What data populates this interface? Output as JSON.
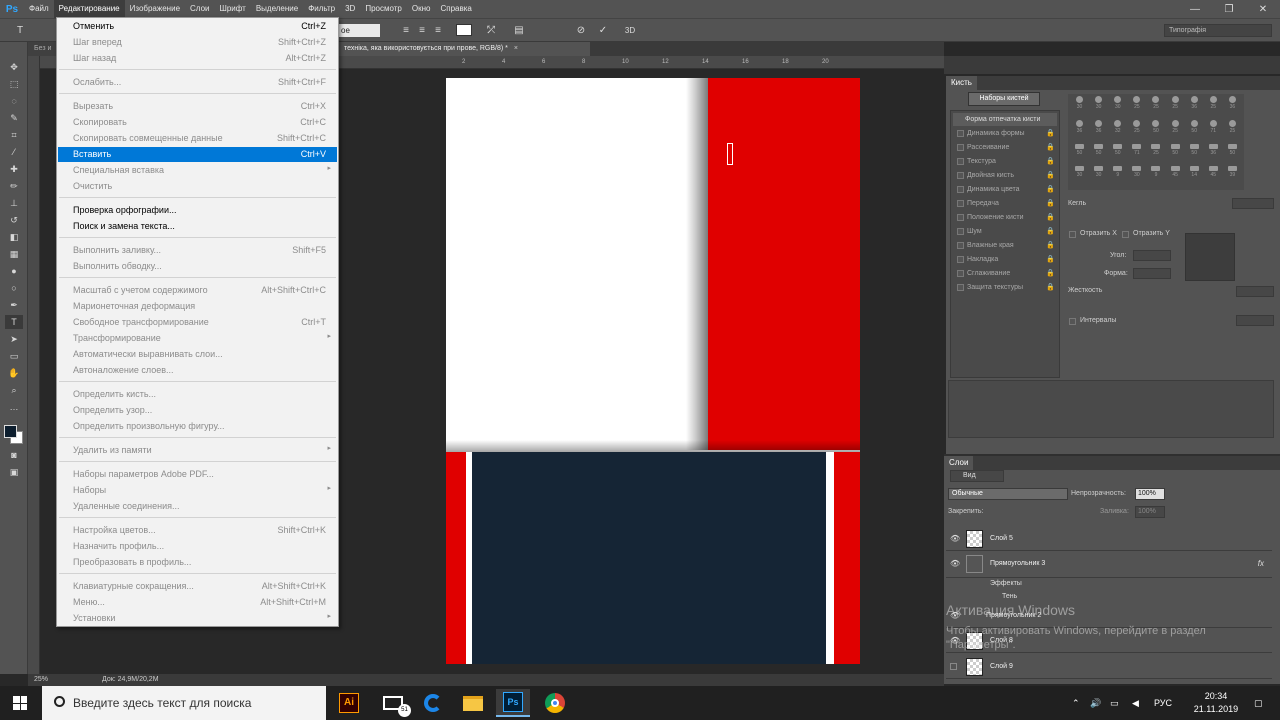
{
  "menubar": {
    "items": [
      "Файл",
      "Редактирование",
      "Изображение",
      "Слои",
      "Шрифт",
      "Выделение",
      "Фильтр",
      "3D",
      "Просмотр",
      "Окно",
      "Справка"
    ],
    "logo": "Ps"
  },
  "options": {
    "font_style": "ое",
    "preset": "Типографія"
  },
  "tabs": [
    {
      "title": "Без и",
      "active": false
    },
    {
      "title": "техніка, яка використовується при прове, RGB/8) *",
      "active": true,
      "close": "×"
    }
  ],
  "ruler_ticks": [
    "2",
    "4",
    "6",
    "8",
    "10",
    "12",
    "14",
    "16",
    "18",
    "20"
  ],
  "canvas_colors": {
    "red": "#e00000",
    "navy": "#152535",
    "white": "#ffffff",
    "grey": "#d8d8d8"
  },
  "edit_menu": {
    "items": [
      {
        "label": "Отменить",
        "shortcut": "Ctrl+Z",
        "disabled": false
      },
      {
        "label": "Шаг вперед",
        "shortcut": "Shift+Ctrl+Z",
        "disabled": true
      },
      {
        "label": "Шаг назад",
        "shortcut": "Alt+Ctrl+Z",
        "disabled": true
      },
      {
        "label": "Ослабить...",
        "shortcut": "Shift+Ctrl+F",
        "disabled": true
      },
      {
        "label": "Вырезать",
        "shortcut": "Ctrl+X",
        "disabled": true
      },
      {
        "label": "Скопировать",
        "shortcut": "Ctrl+C",
        "disabled": true
      },
      {
        "label": "Скопировать совмещенные данные",
        "shortcut": "Shift+Ctrl+C",
        "disabled": true
      },
      {
        "label": "Вставить",
        "shortcut": "Ctrl+V",
        "disabled": false,
        "highlighted": true
      },
      {
        "label": "Специальная вставка",
        "shortcut": "",
        "disabled": true,
        "submenu": true
      },
      {
        "label": "Очистить",
        "shortcut": "",
        "disabled": true
      },
      {
        "label": "Проверка орфографии...",
        "shortcut": "",
        "disabled": false
      },
      {
        "label": "Поиск и замена текста...",
        "shortcut": "",
        "disabled": false
      },
      {
        "label": "Выполнить заливку...",
        "shortcut": "Shift+F5",
        "disabled": true
      },
      {
        "label": "Выполнить обводку...",
        "shortcut": "",
        "disabled": true
      },
      {
        "label": "Масштаб с учетом содержимого",
        "shortcut": "Alt+Shift+Ctrl+C",
        "disabled": true
      },
      {
        "label": "Марионеточная деформация",
        "shortcut": "",
        "disabled": true
      },
      {
        "label": "Свободное трансформирование",
        "shortcut": "Ctrl+T",
        "disabled": true
      },
      {
        "label": "Трансформирование",
        "shortcut": "",
        "disabled": true,
        "submenu": true
      },
      {
        "label": "Автоматически выравнивать слои...",
        "shortcut": "",
        "disabled": true
      },
      {
        "label": "Автоналожение слоев...",
        "shortcut": "",
        "disabled": true
      },
      {
        "label": "Определить кисть...",
        "shortcut": "",
        "disabled": true
      },
      {
        "label": "Определить узор...",
        "shortcut": "",
        "disabled": true
      },
      {
        "label": "Определить произвольную фигуру...",
        "shortcut": "",
        "disabled": true
      },
      {
        "label": "Удалить из памяти",
        "shortcut": "",
        "disabled": true,
        "submenu": true
      },
      {
        "label": "Наборы параметров Adobe PDF...",
        "shortcut": "",
        "disabled": true
      },
      {
        "label": "Наборы",
        "shortcut": "",
        "disabled": true,
        "submenu": true
      },
      {
        "label": "Удаленные соединения...",
        "shortcut": "",
        "disabled": true
      },
      {
        "label": "Настройка цветов...",
        "shortcut": "Shift+Ctrl+K",
        "disabled": true
      },
      {
        "label": "Назначить профиль...",
        "shortcut": "",
        "disabled": true
      },
      {
        "label": "Преобразовать в профиль...",
        "shortcut": "",
        "disabled": true
      },
      {
        "label": "Клавиатурные сокращения...",
        "shortcut": "Alt+Shift+Ctrl+K",
        "disabled": true
      },
      {
        "label": "Меню...",
        "shortcut": "Alt+Shift+Ctrl+M",
        "disabled": true
      },
      {
        "label": "Установки",
        "shortcut": "",
        "disabled": true,
        "submenu": true
      }
    ]
  },
  "brush_panel": {
    "tab": "Кисть",
    "presets_button": "Наборы кистей",
    "sections": [
      "Форма отпечатка кисти",
      "Динамика формы",
      "Рассеивание",
      "Текстура",
      "Двойная кисть",
      "Динамика цвета",
      "Передача",
      "Положение кисти",
      "Шум",
      "Влажные края",
      "Накладка",
      "Сглаживание",
      "Защита текстуры"
    ],
    "tips": [
      "30",
      "30",
      "30",
      "25",
      "25",
      "25",
      "36",
      "25",
      "36",
      "36",
      "36",
      "32",
      "25",
      "50",
      "25",
      "50",
      "71",
      "25",
      "50",
      "50",
      "50",
      "71",
      "25",
      "50",
      "50",
      "36",
      "50",
      "30",
      "30",
      "9",
      "30",
      "9",
      "45",
      "14",
      "45",
      "39"
    ],
    "size_label": "Кегль",
    "flip_x": "Отразить X",
    "flip_y": "Отразить Y",
    "angle_label": "Угол:",
    "roundness_label": "Форма:",
    "hardness_label": "Жесткость",
    "spacing_label": "Интервалы"
  },
  "layers_panel": {
    "tab": "Слои",
    "filter": "Вид",
    "blend_mode": "Обычные",
    "opacity_label": "Непрозрачность:",
    "opacity_value": "100%",
    "lock_label": "Закрепить:",
    "fill_label": "Заливка:",
    "fill_value": "100%",
    "layers": [
      {
        "name": "Слой 5",
        "visible": true
      },
      {
        "name": "Прямоугольник 3",
        "visible": true,
        "fx": "fx"
      },
      {
        "name": "Эффекты",
        "sub": true
      },
      {
        "name": "Тень",
        "sub": true
      },
      {
        "name": "Прямоугольник 2",
        "visible": true
      },
      {
        "name": "Слой 8",
        "visible": true
      },
      {
        "name": "Слой 9",
        "visible": false
      }
    ]
  },
  "status": {
    "zoom": "25%",
    "doc": "Док: 24,9M/20,2M"
  },
  "watermark": {
    "title": "Активация Windows",
    "text": "Чтобы активировать Windows, перейдите в раздел \"Параметры\"."
  },
  "taskbar": {
    "search_placeholder": "Введите здесь текст для поиска",
    "mail_badge": "51",
    "lang": "РУС",
    "time": "20:34",
    "date": "21.11.2019"
  }
}
